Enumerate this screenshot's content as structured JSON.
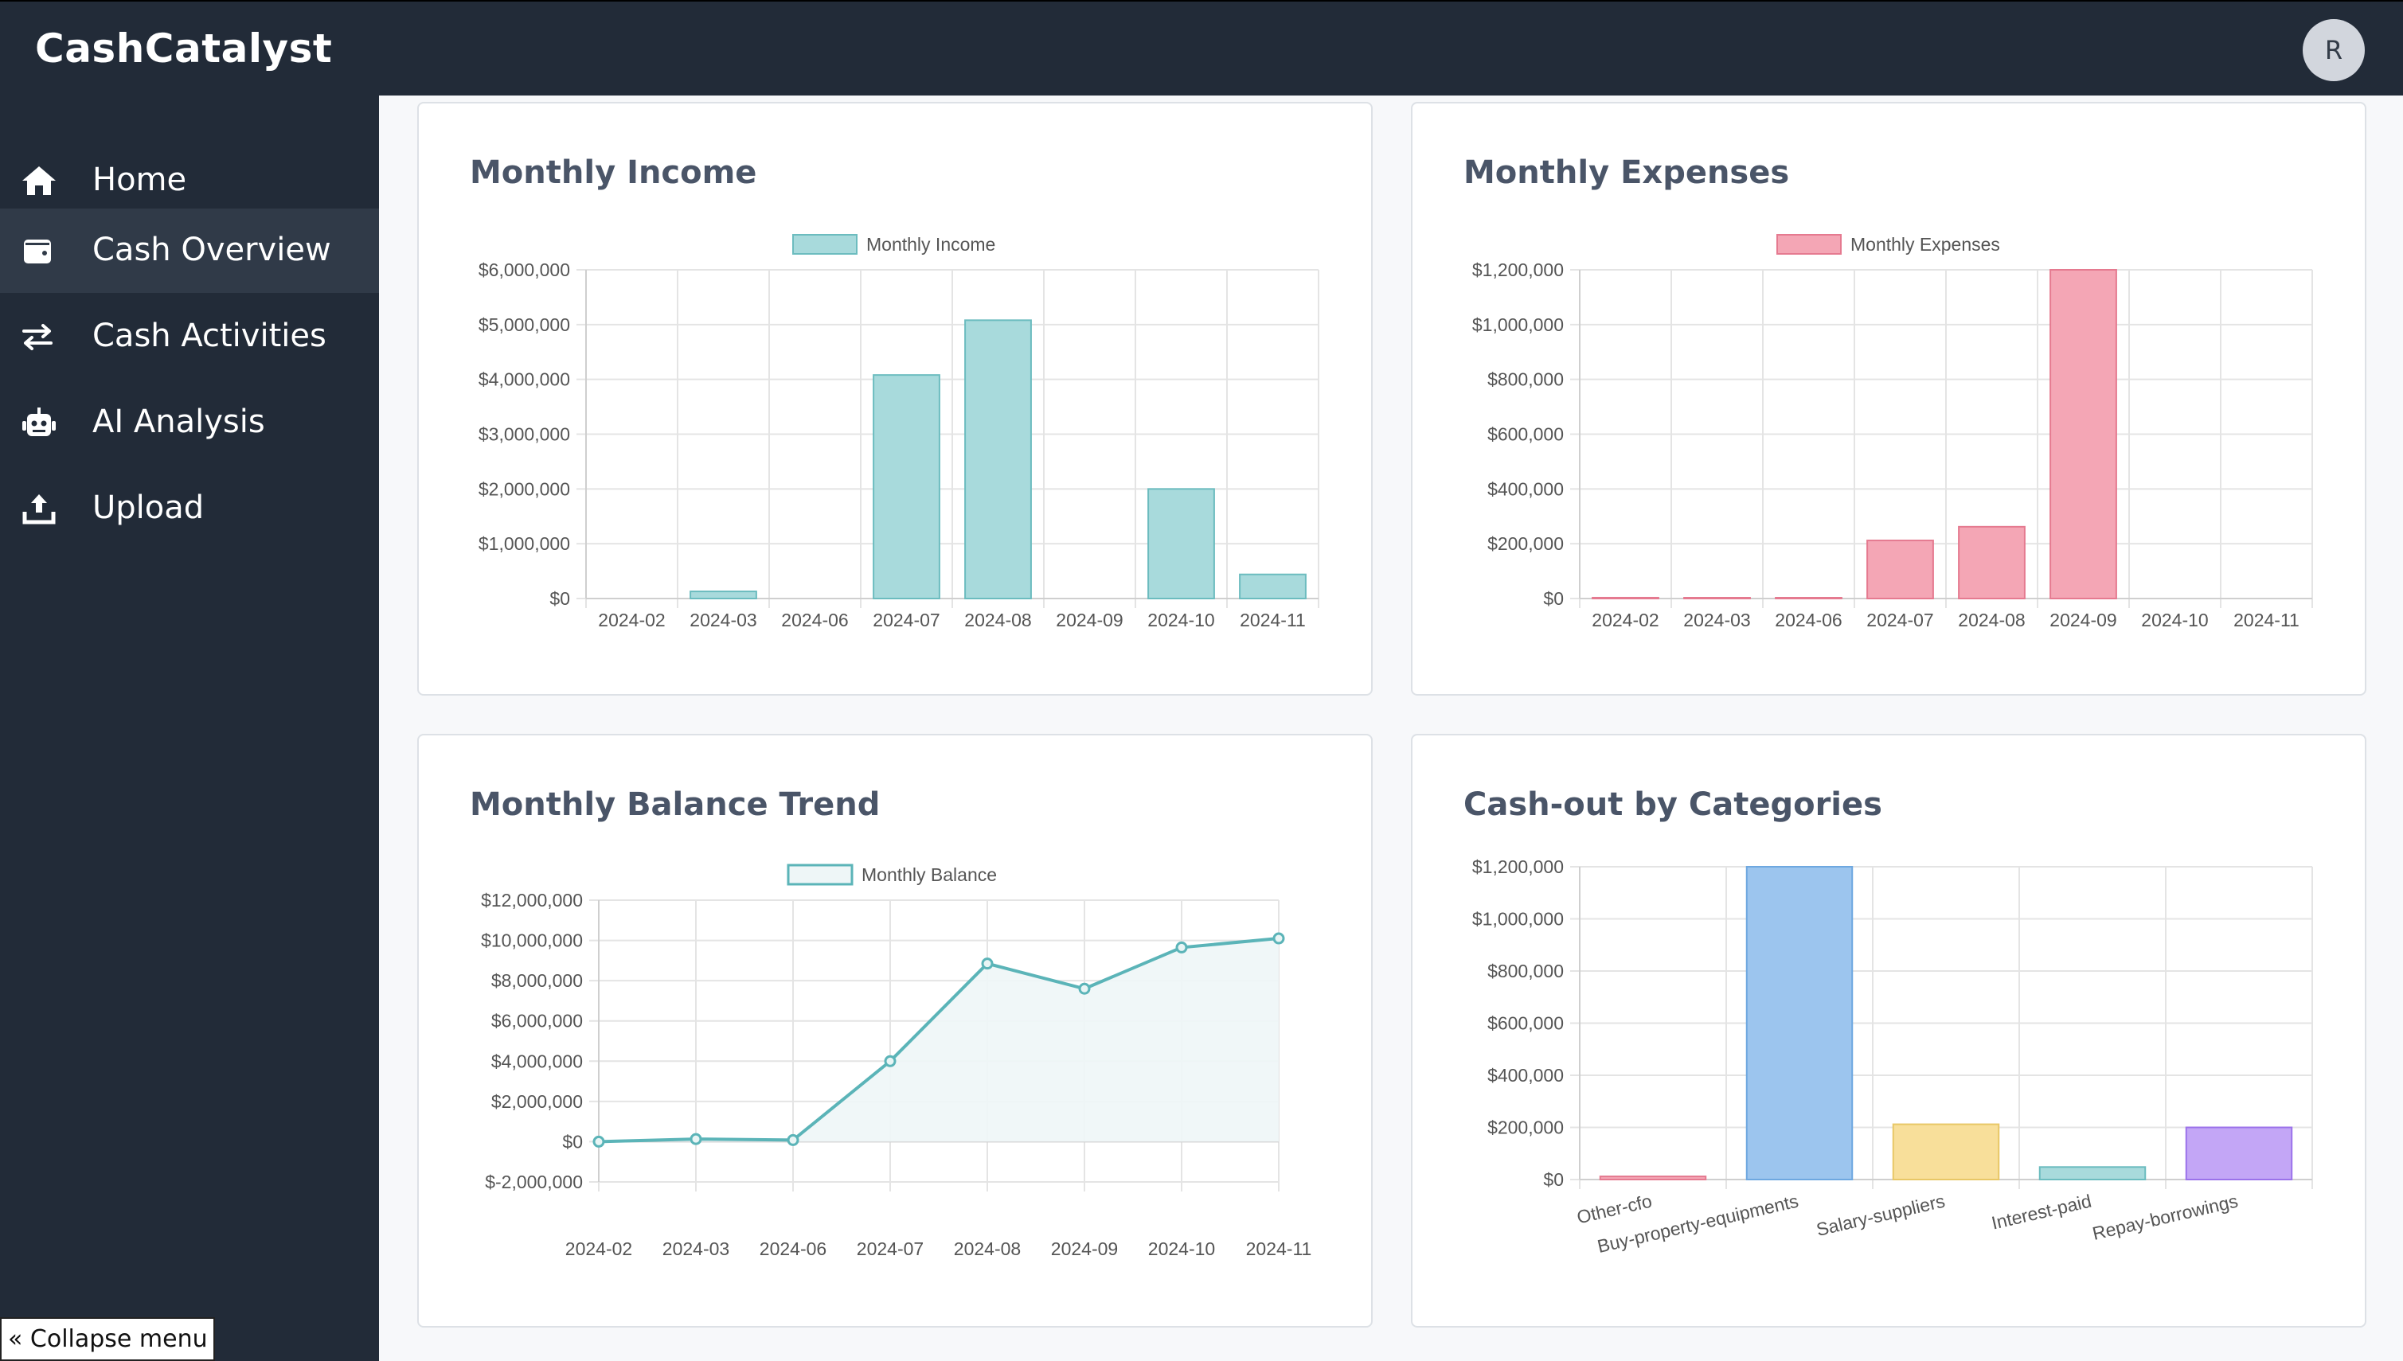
{
  "app": {
    "title": "CashCatalyst",
    "user_initial": "R"
  },
  "sidebar": {
    "items": [
      {
        "label": "Home",
        "icon": "home-icon",
        "active": false
      },
      {
        "label": "Cash Overview",
        "icon": "wallet-icon",
        "active": true
      },
      {
        "label": "Cash Activities",
        "icon": "transfer-icon",
        "active": false
      },
      {
        "label": "AI Analysis",
        "icon": "robot-icon",
        "active": false
      },
      {
        "label": "Upload",
        "icon": "upload-icon",
        "active": false
      }
    ],
    "collapse_label": "Collapse menu"
  },
  "cards": {
    "income": {
      "title": "Monthly Income"
    },
    "expenses": {
      "title": "Monthly Expenses"
    },
    "balance": {
      "title": "Monthly Balance Trend"
    },
    "categories": {
      "title": "Cash-out by Categories"
    }
  },
  "chart_data": [
    {
      "id": "income",
      "type": "bar",
      "title": "Monthly Income",
      "categories": [
        "2024-02",
        "2024-03",
        "2024-06",
        "2024-07",
        "2024-08",
        "2024-09",
        "2024-10",
        "2024-11"
      ],
      "series": [
        {
          "name": "Monthly Income",
          "values": [
            0,
            130000,
            0,
            4080000,
            5080000,
            0,
            2000000,
            440000
          ]
        }
      ],
      "ylim": [
        0,
        6000000
      ],
      "yticks": [
        "$0",
        "$1,000,000",
        "$2,000,000",
        "$3,000,000",
        "$4,000,000",
        "$5,000,000",
        "$6,000,000"
      ],
      "colors": {
        "fill": "#a8dadc",
        "stroke": "#6cbcbf"
      },
      "grid": true,
      "legend": "top"
    },
    {
      "id": "expenses",
      "type": "bar",
      "title": "Monthly Expenses",
      "categories": [
        "2024-02",
        "2024-03",
        "2024-06",
        "2024-07",
        "2024-08",
        "2024-09",
        "2024-10",
        "2024-11"
      ],
      "series": [
        {
          "name": "Monthly Expenses",
          "values": [
            3000,
            1000,
            2000,
            212000,
            262000,
            1200000,
            0,
            0
          ]
        }
      ],
      "ylim": [
        0,
        1200000
      ],
      "yticks": [
        "$0",
        "$200,000",
        "$400,000",
        "$600,000",
        "$800,000",
        "$1,000,000",
        "$1,200,000"
      ],
      "colors": {
        "fill": "#f4a6b5",
        "stroke": "#e57a90"
      },
      "grid": true,
      "legend": "top"
    },
    {
      "id": "balance",
      "type": "area",
      "title": "Monthly Balance Trend",
      "categories": [
        "2024-02",
        "2024-03",
        "2024-06",
        "2024-07",
        "2024-08",
        "2024-09",
        "2024-10",
        "2024-11"
      ],
      "series": [
        {
          "name": "Monthly Balance",
          "values": [
            0,
            130000,
            80000,
            4000000,
            8850000,
            7600000,
            9650000,
            10100000
          ]
        }
      ],
      "ylim": [
        -2000000,
        12000000
      ],
      "yticks": [
        "$-2,000,000",
        "$0",
        "$2,000,000",
        "$4,000,000",
        "$6,000,000",
        "$8,000,000",
        "$10,000,000",
        "$12,000,000"
      ],
      "colors": {
        "line": "#5bb4b8",
        "fill": "#eef6f7"
      },
      "grid": true,
      "legend": "top"
    },
    {
      "id": "categories",
      "type": "bar",
      "title": "Cash-out by Categories",
      "categories": [
        "Other-cfo",
        "Buy-property-equipments",
        "Salary-suppliers",
        "Interest-paid",
        "Repay-borrowings"
      ],
      "series": [
        {
          "values": [
            12000,
            1200000,
            212000,
            48000,
            200000
          ]
        }
      ],
      "ylim": [
        0,
        1200000
      ],
      "yticks": [
        "$0",
        "$200,000",
        "$400,000",
        "$600,000",
        "$800,000",
        "$1,000,000",
        "$1,200,000"
      ],
      "colors": {
        "fills": [
          "#f4a6b5",
          "#9cc5ee",
          "#f8df9a",
          "#a8dadc",
          "#c3a6f6"
        ],
        "strokes": [
          "#e57a90",
          "#6ea8e0",
          "#e8c766",
          "#6cbcbf",
          "#9b72ea"
        ]
      },
      "grid": true,
      "legend": "none"
    }
  ]
}
